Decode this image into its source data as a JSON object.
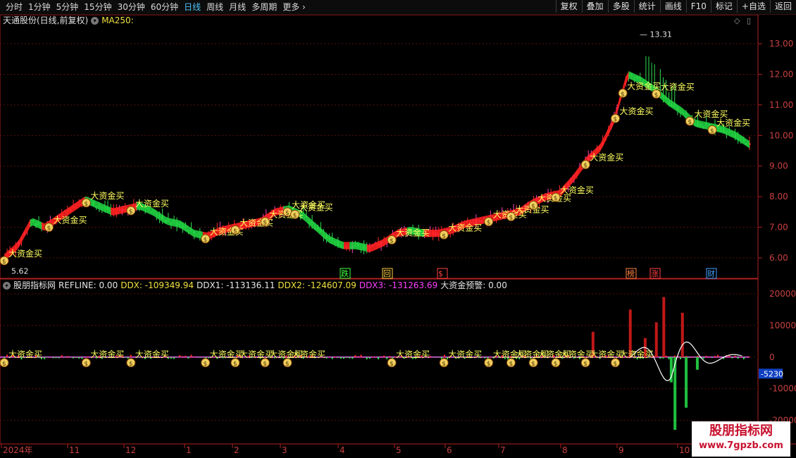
{
  "toolbar": {
    "periods": [
      "分时",
      "1分钟",
      "5分钟",
      "15分钟",
      "30分钟",
      "60分钟",
      "日线",
      "周线",
      "月线",
      "多周期",
      "更多"
    ],
    "active": "日线",
    "right_buttons": [
      "复权",
      "叠加",
      "多股",
      "统计",
      "画线",
      "F10",
      "标记",
      "+自选",
      "返回"
    ]
  },
  "main_panel": {
    "title": "天通股份(日线,前复权)",
    "ma_label": "MA250:",
    "y_ticks": [
      "13.00",
      "12.00",
      "11.00",
      "10.00",
      "9.00",
      "8.00",
      "7.00",
      "6.00"
    ],
    "high_label": "13.31",
    "low_label": "5.62",
    "event_markers": [
      {
        "label": "跌",
        "color": "#40ff40"
      },
      {
        "label": "回",
        "color": "#ffd040"
      },
      {
        "label": "$",
        "color": "#ff4040"
      },
      {
        "label": "榜",
        "color": "#ff8040"
      },
      {
        "label": "涨",
        "color": "#ff4040"
      },
      {
        "label": "财",
        "color": "#40a0ff"
      }
    ],
    "signal_text": "大资金买"
  },
  "sub_panel": {
    "name": "股朋指标网",
    "refline": "REFLINE: 0.00",
    "ddx": "DDX: -109349.94",
    "ddx1": "DDX1: -113136.11",
    "ddx2": "DDX2: -124607.09",
    "ddx3": "DDX3: -131263.69",
    "alert": "大资金预警: 0.00",
    "y_ticks": [
      "20000",
      "10000",
      "0",
      "-10000",
      "-20000"
    ],
    "current_value": "-5230",
    "signal_text": "大资金买"
  },
  "x_axis": [
    "2024年",
    "11",
    "12",
    "1",
    "2",
    "3",
    "4",
    "5",
    "6",
    "7",
    "8",
    "9",
    "10"
  ],
  "watermark": {
    "line1": "股朋指标网",
    "line2": "www.7gpzb.com"
  },
  "colors": {
    "up": "#ff2a2a",
    "down": "#30e050",
    "grid": "#5a1010",
    "axis": "#b02020",
    "accent": "#4fc3f7"
  },
  "chart_data": {
    "type": "candlestick",
    "price_range": [
      5.4,
      13.6
    ],
    "price_series": [
      6.0,
      6.4,
      7.2,
      7.0,
      7.3,
      7.6,
      7.9,
      7.7,
      7.5,
      7.6,
      7.7,
      7.5,
      7.2,
      7.1,
      6.8,
      6.7,
      6.9,
      7.0,
      7.1,
      7.2,
      7.5,
      7.6,
      7.4,
      7.0,
      6.6,
      6.4,
      6.4,
      6.3,
      6.5,
      6.8,
      6.9,
      6.8,
      6.8,
      6.9,
      7.1,
      7.2,
      7.3,
      7.4,
      7.5,
      7.8,
      8.0,
      8.1,
      8.6,
      9.2,
      9.6,
      10.5,
      12.0,
      11.8,
      11.5,
      11.1,
      10.8,
      10.4,
      10.3,
      10.2,
      10.0,
      9.7
    ],
    "ddx_range": [
      -27000,
      22000
    ],
    "ddx_spikes": [
      {
        "x": 0.79,
        "v": 8000
      },
      {
        "x": 0.84,
        "v": 15000
      },
      {
        "x": 0.86,
        "v": 6000
      },
      {
        "x": 0.875,
        "v": 11000
      },
      {
        "x": 0.885,
        "v": 19000
      },
      {
        "x": 0.91,
        "v": 14000
      },
      {
        "x": 0.9,
        "v": -23000
      },
      {
        "x": 0.915,
        "v": -16000
      },
      {
        "x": 0.895,
        "v": -8000
      },
      {
        "x": 0.93,
        "v": -4000
      }
    ]
  }
}
